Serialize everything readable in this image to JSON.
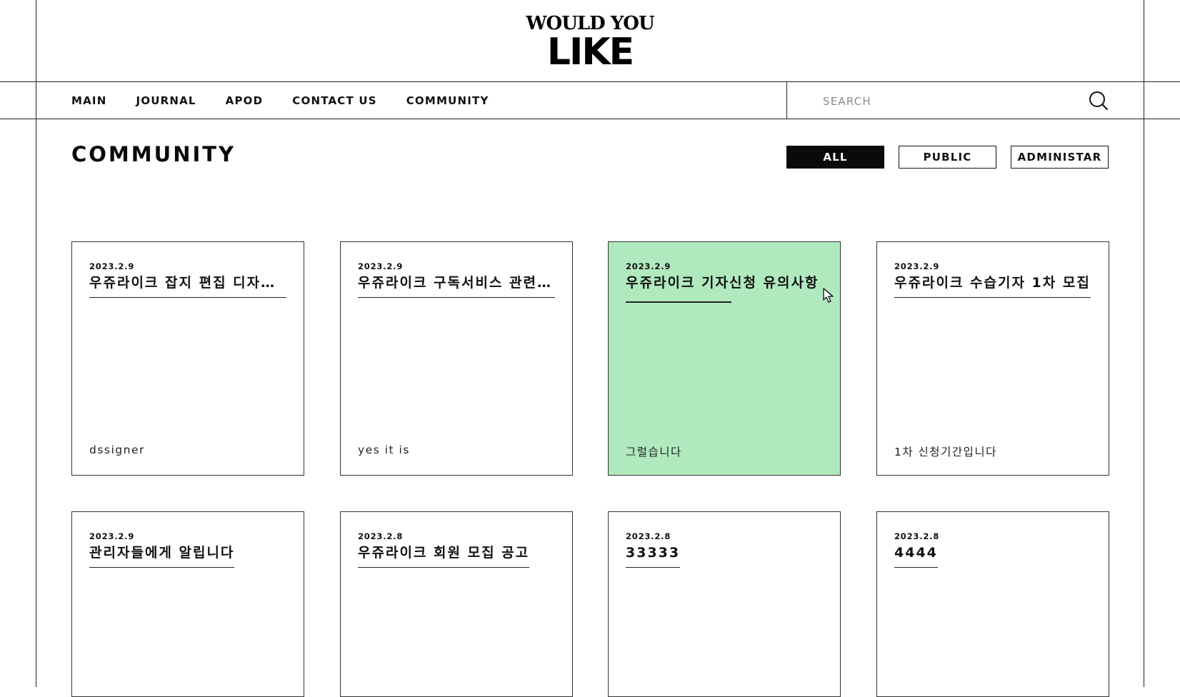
{
  "brand": {
    "logo_top": "WOULD YOU",
    "logo_bottom": "LIKE"
  },
  "nav": {
    "items": [
      {
        "label": "MAIN"
      },
      {
        "label": "JOURNAL"
      },
      {
        "label": "APOD"
      },
      {
        "label": "CONTACT US"
      },
      {
        "label": "COMMUNITY"
      }
    ]
  },
  "search": {
    "placeholder": "SEARCH",
    "icon": "search-icon"
  },
  "page": {
    "title": "COMMUNITY"
  },
  "filters": [
    {
      "label": "ALL",
      "active": true
    },
    {
      "label": "PUBLIC",
      "active": false
    },
    {
      "label": "ADMINISTAR",
      "active": false
    }
  ],
  "posts": [
    {
      "date": "2023.2.9",
      "title": "우쥬라이크 잡지 편집 디자이너 모집",
      "author": "dssigner"
    },
    {
      "date": "2023.2.9",
      "title": "우쥬라이크 구독서비스 관련 공지",
      "author": "yes it is"
    },
    {
      "date": "2023.2.9",
      "title": "우쥬라이크 기자신청 유의사항",
      "author": "그럴습니다",
      "highlight_color": "#b0e9be"
    },
    {
      "date": "2023.2.9",
      "title": "우쥬라이크 수습기자 1차 모집",
      "author": "1차 신청기간입니다"
    },
    {
      "date": "2023.2.9",
      "title": "관리자들에게 알립니다",
      "author": ""
    },
    {
      "date": "2023.2.8",
      "title": "우쥬라이크 회원 모집 공고",
      "author": ""
    },
    {
      "date": "2023.2.8",
      "title": "33333",
      "author": ""
    },
    {
      "date": "2023.2.8",
      "title": "4444",
      "author": ""
    }
  ]
}
